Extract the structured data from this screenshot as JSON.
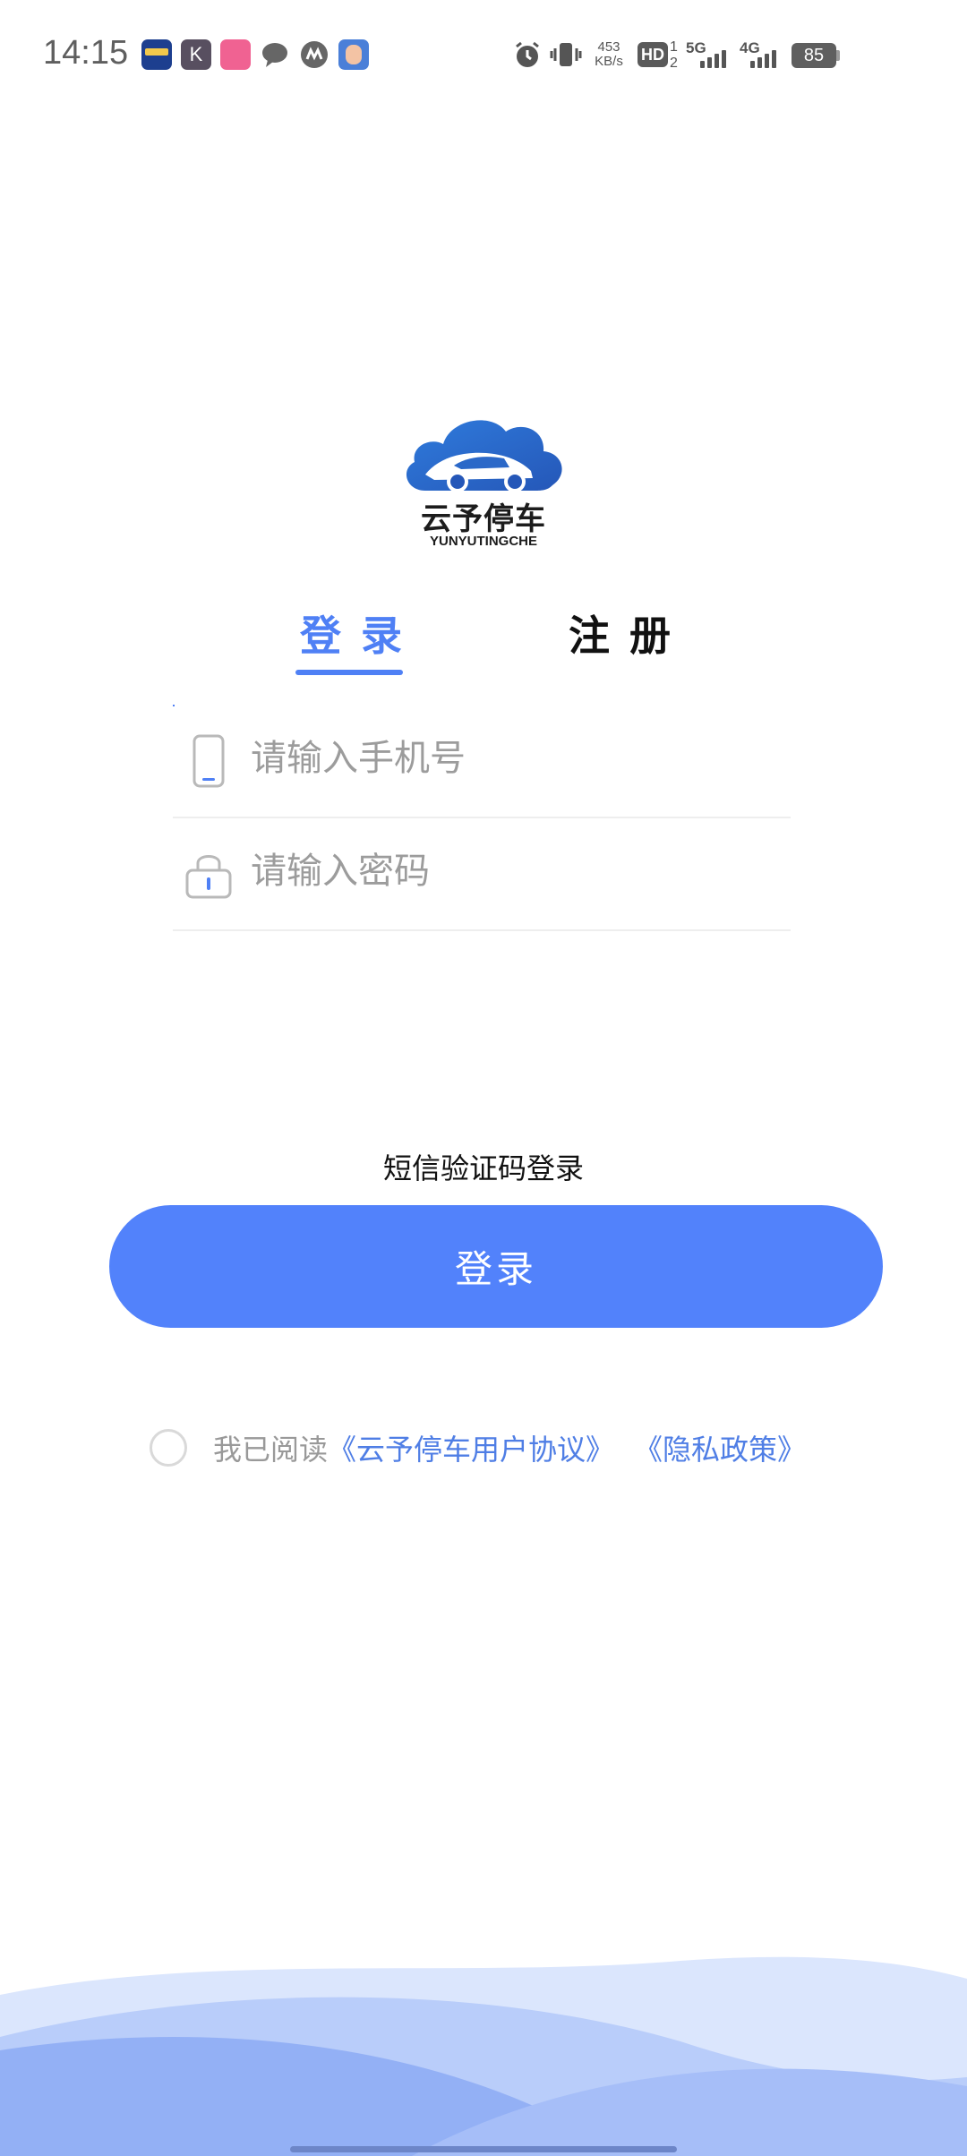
{
  "status_bar": {
    "time": "14:15",
    "net_speed_value": "453",
    "net_speed_unit": "KB/s",
    "hd_label": "HD",
    "network_5g": "5G",
    "network_4g": "4G",
    "battery_level": "85",
    "app_icons": [
      "app-icon-1",
      "keep-app-icon",
      "lofter-app-icon",
      "message-bubble-icon",
      "merchants-bank-icon",
      "game-app-icon"
    ],
    "system_icons": [
      "alarm-icon",
      "vibrate-icon"
    ]
  },
  "logo": {
    "name_cn": "云予停车",
    "name_en": "YUNYUTINGCHE"
  },
  "tabs": {
    "login": "登录",
    "register": "注册"
  },
  "form": {
    "phone_placeholder": "请输入手机号",
    "password_placeholder": "请输入密码"
  },
  "sms_login_label": "短信验证码登录",
  "login_button_label": "登录",
  "agreement": {
    "prefix": "我已阅读",
    "user_agreement": "《云予停车用户协议》",
    "privacy_policy": "《隐私政策》"
  },
  "colors": {
    "accent": "#5282fb",
    "tab_active": "#4f80f5",
    "link": "#4f7ee5",
    "placeholder": "#9c9c9c"
  }
}
